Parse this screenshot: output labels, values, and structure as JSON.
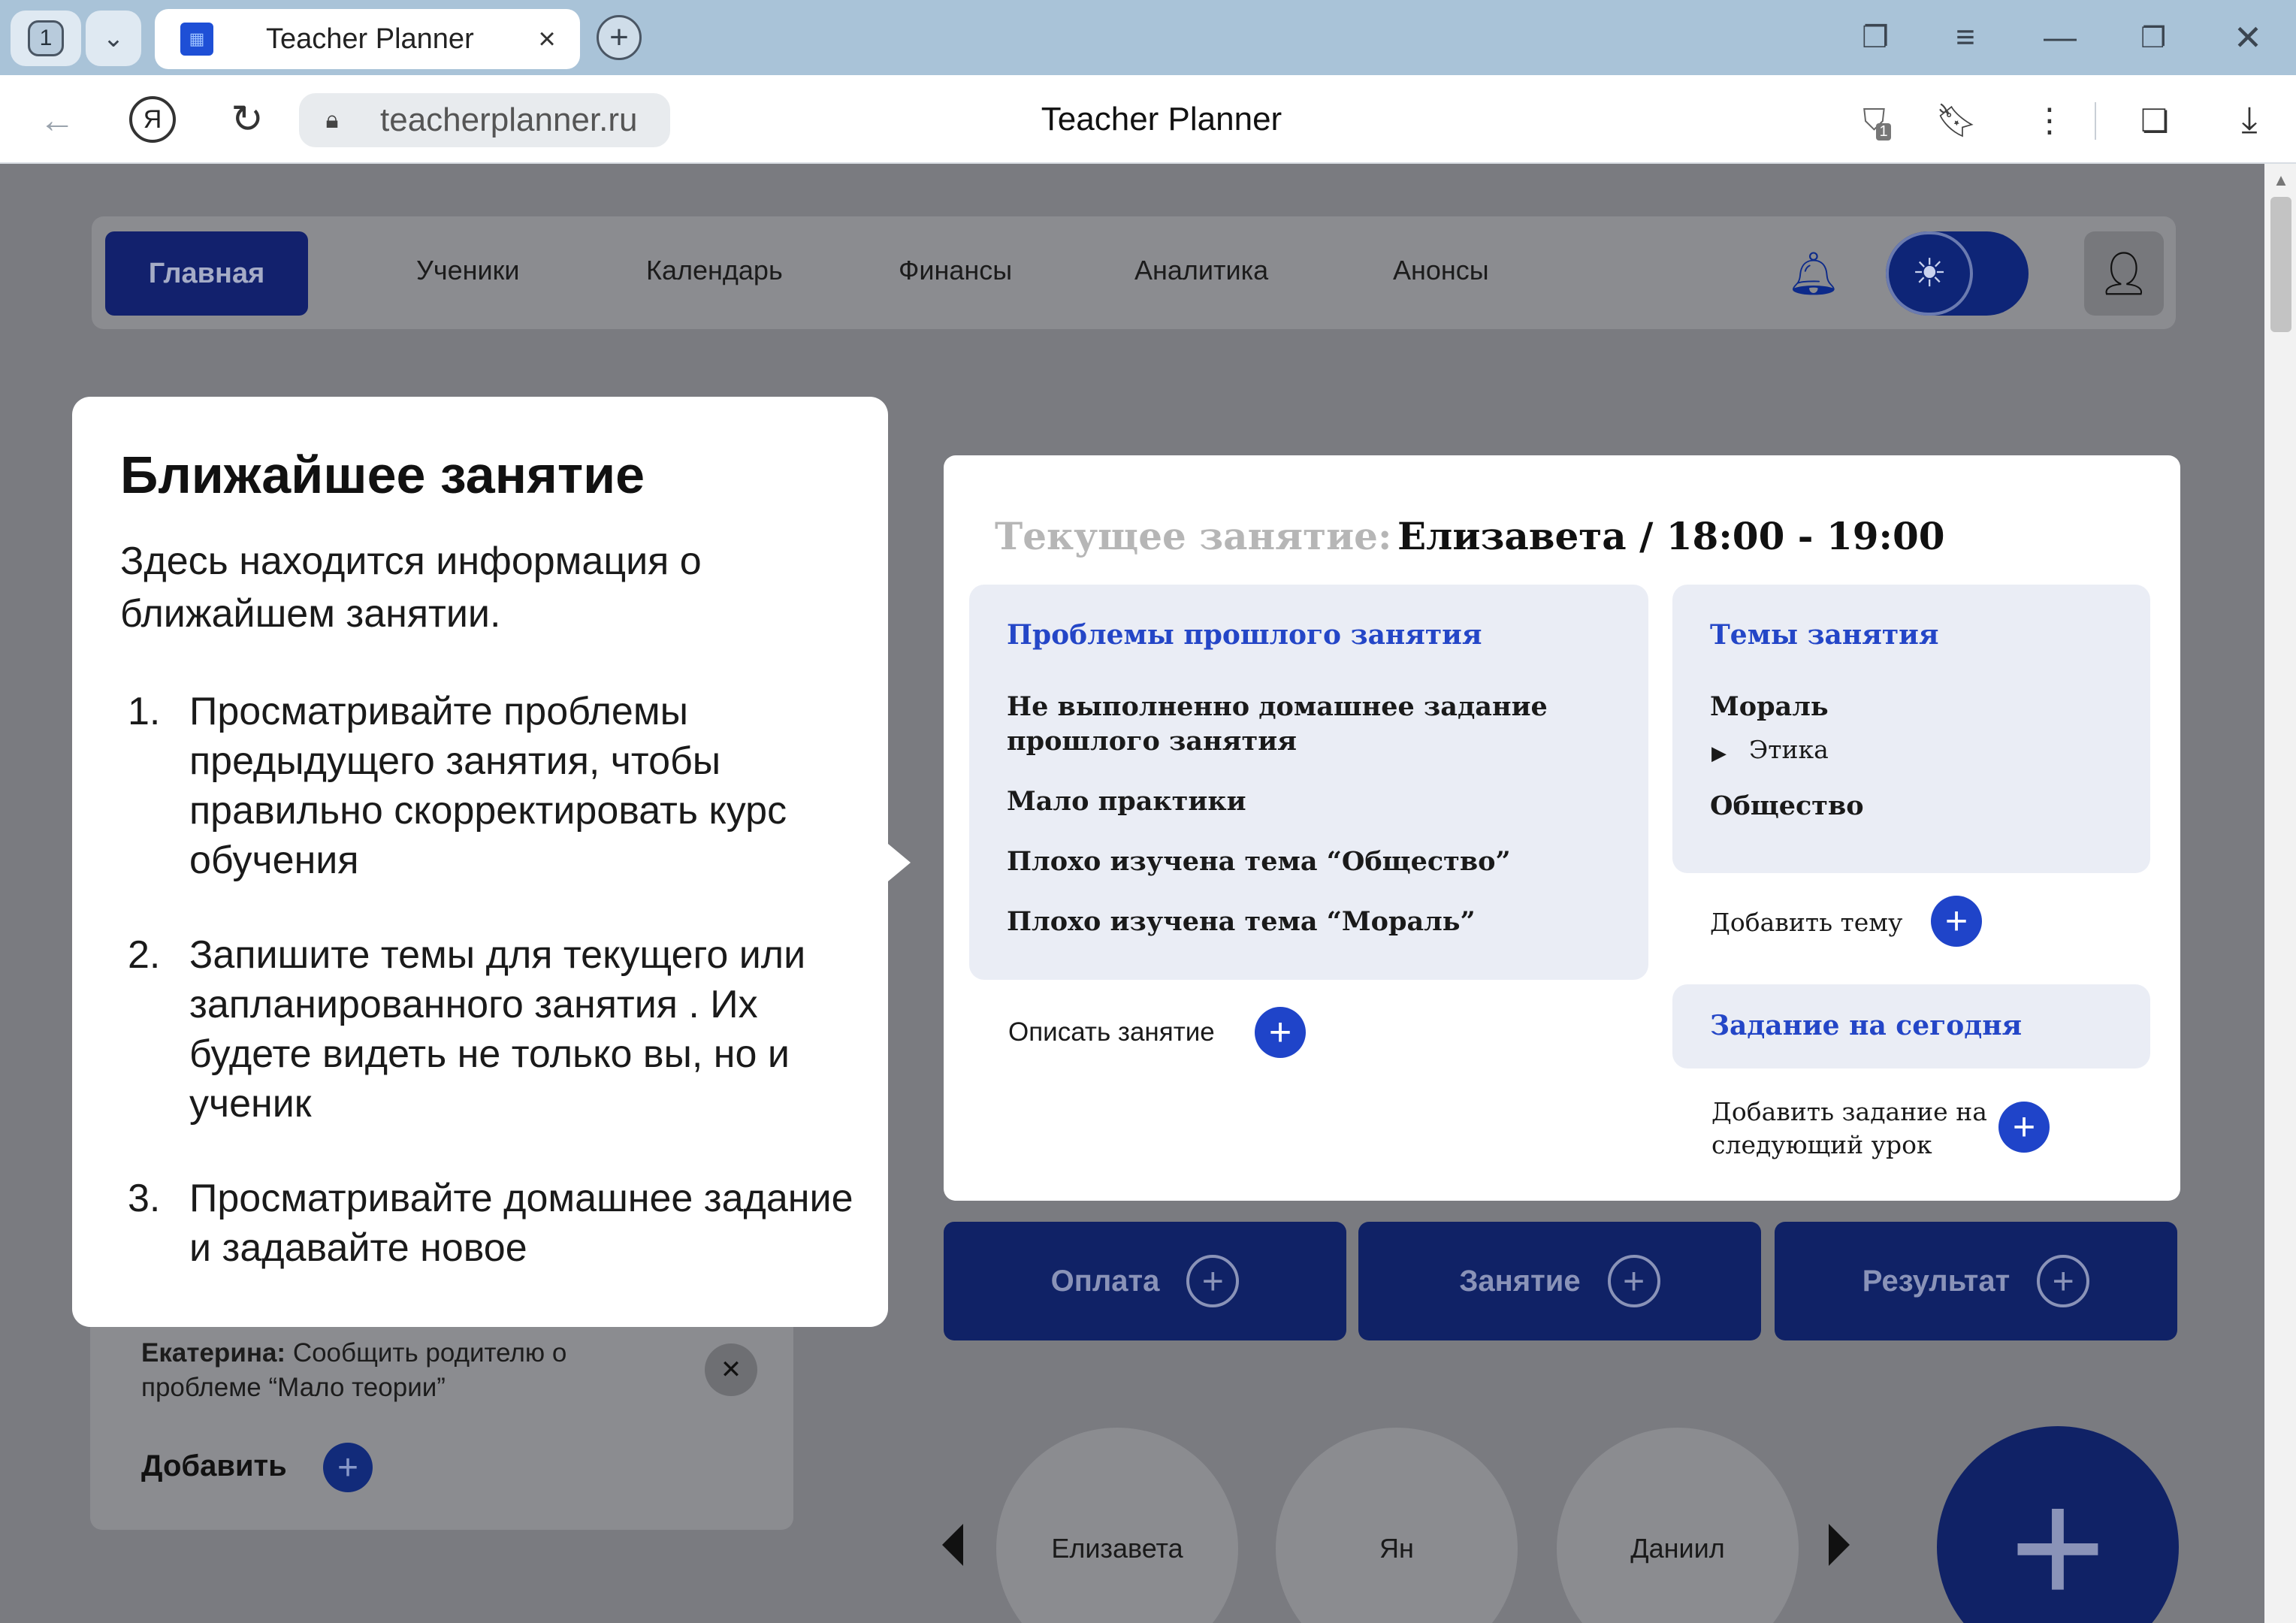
{
  "browser": {
    "tab_count": "1",
    "tab_title": "Teacher Planner",
    "url": "teacherplanner.ru",
    "page_title": "Teacher Planner",
    "shield_badge": "1"
  },
  "nav": {
    "home": "Главная",
    "students": "Ученики",
    "calendar": "Календарь",
    "finance": "Финансы",
    "analytics": "Аналитика",
    "announcements": "Анонсы"
  },
  "reminder": {
    "name": "Екатерина:",
    "text": " Сообщить родителю о проблеме “Мало теории”",
    "add_label": "Добавить"
  },
  "tooltip": {
    "title": "Ближайшее занятие",
    "intro": "Здесь находится информация о ближайшем занятии.",
    "steps": [
      {
        "num": "1.",
        "text": "Просматривайте проблемы предыдущего занятия, чтобы правильно скорректировать курс обучения"
      },
      {
        "num": "2.",
        "text": "Запишите темы для текущего или запланированного занятия . Их будете видеть не только вы, но и ученик"
      },
      {
        "num": "3.",
        "text": "Просматривайте домашнее задание и задавайте новое"
      }
    ]
  },
  "lesson": {
    "label": "Текущее занятие:",
    "value": "Елизавета / 18:00 - 19:00",
    "problems_title": "Проблемы прошлого занятия",
    "problems": [
      "Не выполненно домашнее задание прошлого занятия",
      "Мало практики",
      "Плохо изучена тема “Общество”",
      "Плохо изучена тема “Мораль”"
    ],
    "describe_label": "Описать занятие",
    "topics_title": "Темы занятия",
    "topics": [
      "Мораль",
      "Этика",
      "Общество"
    ],
    "add_topic_label": "Добавить тему",
    "homework_title": "Задание на сегодня",
    "add_homework_label": "Добавить задание на следующий урок"
  },
  "actions": {
    "payment": "Оплата",
    "lesson": "Занятие",
    "result": "Результат"
  },
  "students": [
    "Елизавета",
    "Ян",
    "Даниил"
  ],
  "icons": {
    "bell": "bell-icon",
    "theme": "sun-icon",
    "profile": "user-icon",
    "plus": "plus-icon"
  },
  "colors": {
    "accent": "#1f44c9",
    "dark_navy": "#102266",
    "panel": "#eaedf5"
  }
}
